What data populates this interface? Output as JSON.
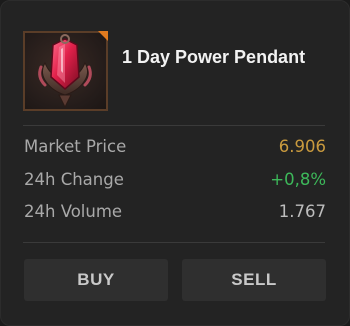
{
  "item": {
    "name": "1 Day Power Pendant",
    "icon": "power-pendant-icon",
    "rarity_color": "#e07a1f"
  },
  "stats": [
    {
      "label": "Market Price",
      "value": "6.906",
      "color": "#c99a3e"
    },
    {
      "label": "24h Change",
      "value": "+0,8%",
      "color": "#3db85a"
    },
    {
      "label": "24h Volume",
      "value": "1.767",
      "color": "#bdbdbd"
    }
  ],
  "actions": {
    "buy_label": "BUY",
    "sell_label": "SELL"
  }
}
